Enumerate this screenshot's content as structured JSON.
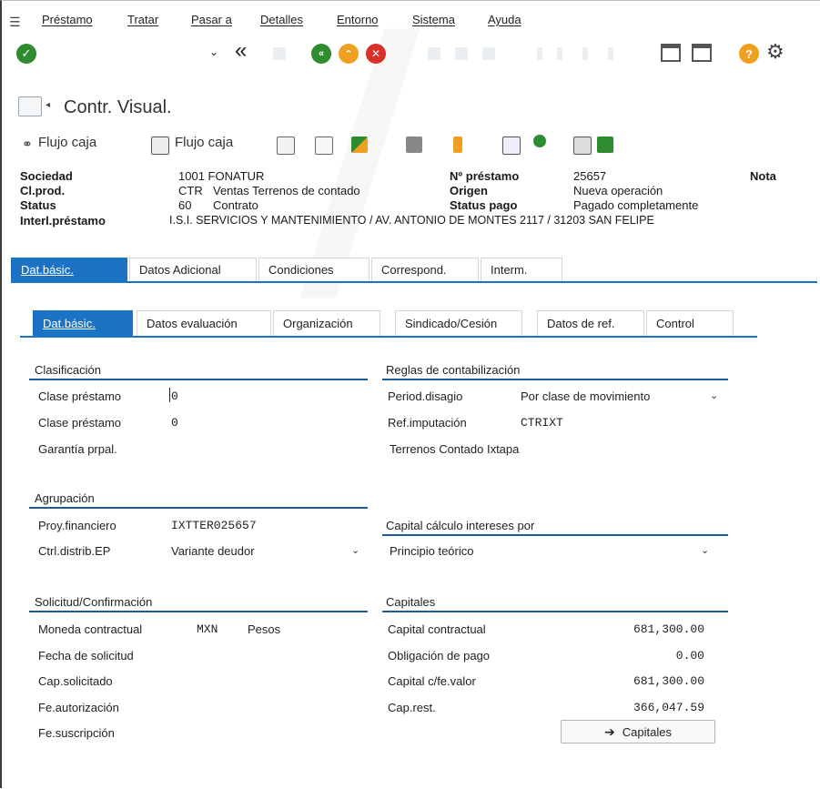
{
  "menu": [
    "Préstamo",
    "Tratar",
    "Pasar a",
    "Detalles",
    "Entorno",
    "Sistema",
    "Ayuda"
  ],
  "toolbar": {
    "nav_back_glyph": "«"
  },
  "title_bar": {
    "title": "Contr. Visual."
  },
  "app_toolbar": {
    "flujo_caja_1": "Flujo caja",
    "flujo_caja_2": "Flujo caja"
  },
  "header": {
    "sociedad_label": "Sociedad",
    "sociedad_value": "1001 FONATUR",
    "clprod_label": "Cl.prod.",
    "clprod_code": "CTR",
    "clprod_desc": "Ventas Terrenos de contado",
    "status_label": "Status",
    "status_code": "60",
    "status_desc": "Contrato",
    "interl_label": "Interl.préstamo",
    "interl_value": "I.S.I. SERVICIOS Y MANTENIMIENTO / AV. ANTONIO DE MONTES 2117 / 31203 SAN FELIPE",
    "nprestamo_label": "Nº préstamo",
    "nprestamo_value": "25657",
    "origen_label": "Origen",
    "origen_value": "Nueva operación",
    "statuspago_label": "Status pago",
    "statuspago_value": "Pagado completamente",
    "nota_label": "Nota"
  },
  "tabs": [
    "Dat.básic.",
    "Datos Adicional",
    "Condiciones",
    "Correspond.",
    "Interm."
  ],
  "subtabs": [
    "Dat.básic.",
    "Datos evaluación",
    "Organización",
    "Sindicado/Cesión",
    "Datos de ref.",
    "Control"
  ],
  "clasificacion": {
    "title": "Clasificación",
    "clase1_label": "Clase préstamo",
    "clase1_value": "0",
    "clase2_label": "Clase préstamo",
    "clase2_value": "0",
    "garantia_label": "Garantía prpal."
  },
  "reglas": {
    "title": "Reglas de contabilización",
    "period_label": "Period.disagio",
    "period_value": "Por clase de movimiento",
    "refimp_label": "Ref.imputación",
    "refimp_value": "CTRIXT",
    "refimp_desc": "Terrenos Contado Ixtapa"
  },
  "agrupacion": {
    "title": "Agrupación",
    "proy_label": "Proy.financiero",
    "proy_value": "IXTTER025657",
    "ctrl_label": "Ctrl.distrib.EP",
    "ctrl_value": "Variante deudor"
  },
  "capital_calc": {
    "title": "Capital cálculo intereses por",
    "value": "Principio teórico"
  },
  "solicitud": {
    "title": "Solicitud/Confirmación",
    "moneda_label": "Moneda contractual",
    "moneda_code": "MXN",
    "moneda_name": "Pesos",
    "fecha_sol_label": "Fecha de solicitud",
    "cap_sol_label": "Cap.solicitado",
    "fe_aut_label": "Fe.autorización",
    "fe_sus_label": "Fe.suscripción"
  },
  "capitales": {
    "title": "Capitales",
    "contractual_label": "Capital contractual",
    "contractual_value": "681,300.00",
    "obligacion_label": "Obligación de pago",
    "obligacion_value": "0.00",
    "cfevalor_label": "Capital c/fe.valor",
    "cfevalor_value": "681,300.00",
    "caprest_label": "Cap.rest.",
    "caprest_value": "366,047.59",
    "button_label": "Capitales"
  },
  "colors": {
    "accent": "#1c73c4",
    "section_line": "#1e5b96",
    "ok_green": "#2e8b2e",
    "warn_orange": "#f0a020",
    "cancel_red": "#d9302a"
  }
}
